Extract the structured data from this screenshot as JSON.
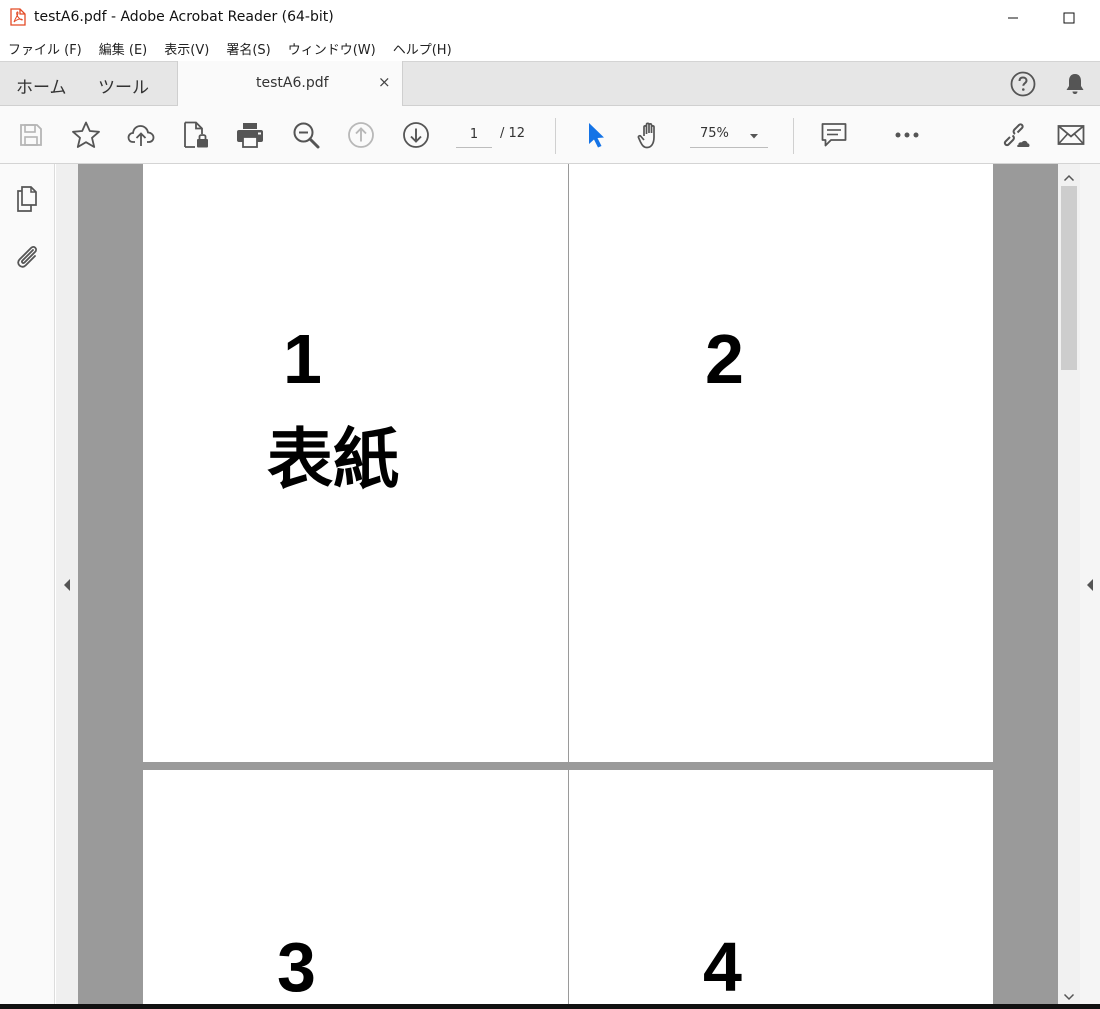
{
  "window": {
    "title": "testA6.pdf - Adobe Acrobat Reader (64-bit)",
    "icon": "acrobat-pdf-icon"
  },
  "menu": {
    "items": [
      "ファイル (F)",
      "編集 (E)",
      "表示(V)",
      "署名(S)",
      "ウィンドウ(W)",
      "ヘルプ(H)"
    ]
  },
  "tabs": {
    "home": "ホーム",
    "tools": "ツール",
    "document": "testA6.pdf",
    "close_glyph": "×"
  },
  "toolbar": {
    "icons": [
      "save-icon",
      "bookmark-star-icon",
      "cloud-upload-icon",
      "protect-file-icon",
      "print-icon",
      "zoom-search-icon",
      "previous-page-icon",
      "next-page-icon",
      "select-cursor-icon",
      "hand-tool-icon",
      "comment-icon",
      "more-icon",
      "share-link-icon",
      "email-icon"
    ],
    "page_current": "1",
    "page_total": "/  12",
    "zoom": "75%"
  },
  "document": {
    "pages": [
      {
        "number": "1",
        "label": "表紙"
      },
      {
        "number": "2"
      },
      {
        "number": "3"
      },
      {
        "number": "4"
      }
    ]
  },
  "colors": {
    "accent_blue": "#1473e6",
    "pdf_red": "#e34a25",
    "doc_background": "#9a9a9a"
  }
}
